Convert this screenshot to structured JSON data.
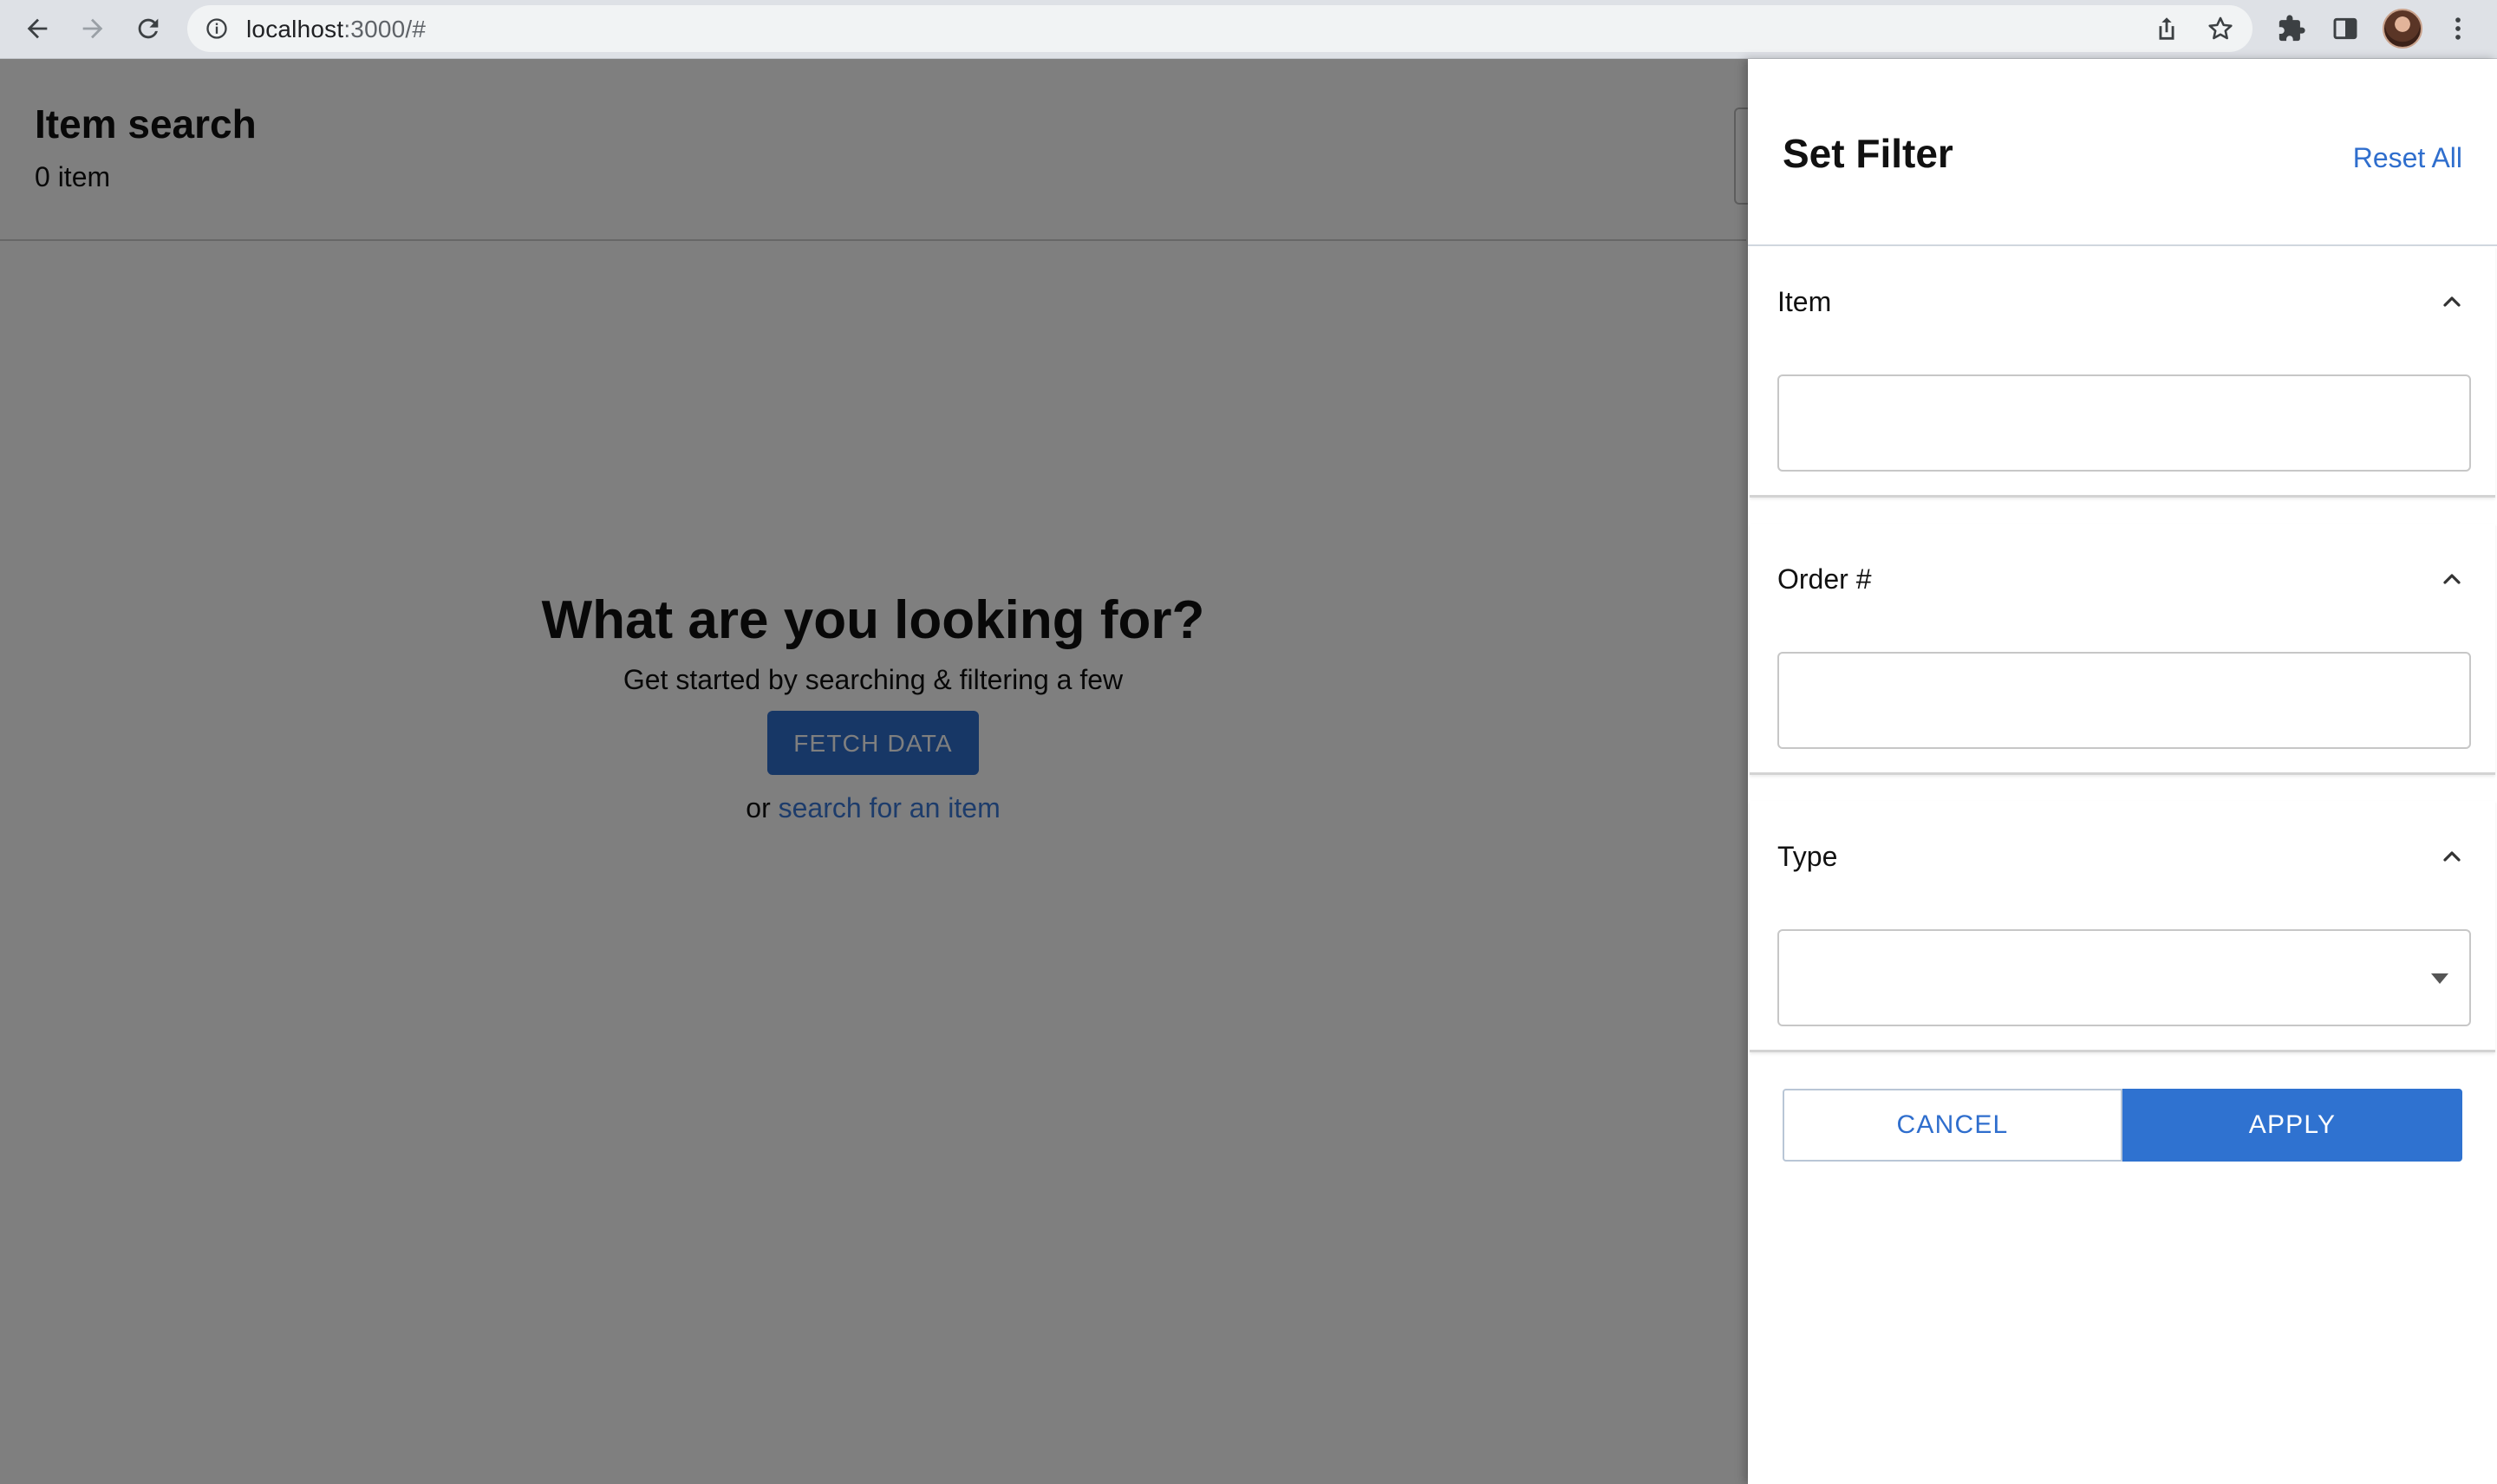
{
  "browser": {
    "url_host": "localhost",
    "url_path": ":3000/#",
    "icons": {
      "back": "arrow-left-icon",
      "forward": "arrow-right-icon",
      "reload": "reload-icon",
      "site_info": "info-icon",
      "share": "share-icon",
      "bookmark": "star-icon",
      "extensions": "puzzle-icon",
      "side_panel": "side-panel-icon",
      "menu": "kebab-menu-icon"
    }
  },
  "app": {
    "title": "Item search",
    "count": "0 item"
  },
  "empty_state": {
    "title": "What are you looking for?",
    "subtitle": "Get started by searching & filtering a few",
    "fetch_button": "FETCH DATA",
    "or_text": "or",
    "search_link": "search for an item"
  },
  "filter_drawer": {
    "title": "Set Filter",
    "reset_label": "Reset All",
    "sections": [
      {
        "label": "Item",
        "value": "",
        "kind": "text"
      },
      {
        "label": "Order #",
        "value": "",
        "kind": "text"
      },
      {
        "label": "Type",
        "value": "",
        "kind": "select"
      }
    ],
    "cancel_label": "CANCEL",
    "apply_label": "APPLY"
  },
  "colors": {
    "accent": "#2f6ecd",
    "backdrop": "rgba(0,0,0,0.5)"
  }
}
